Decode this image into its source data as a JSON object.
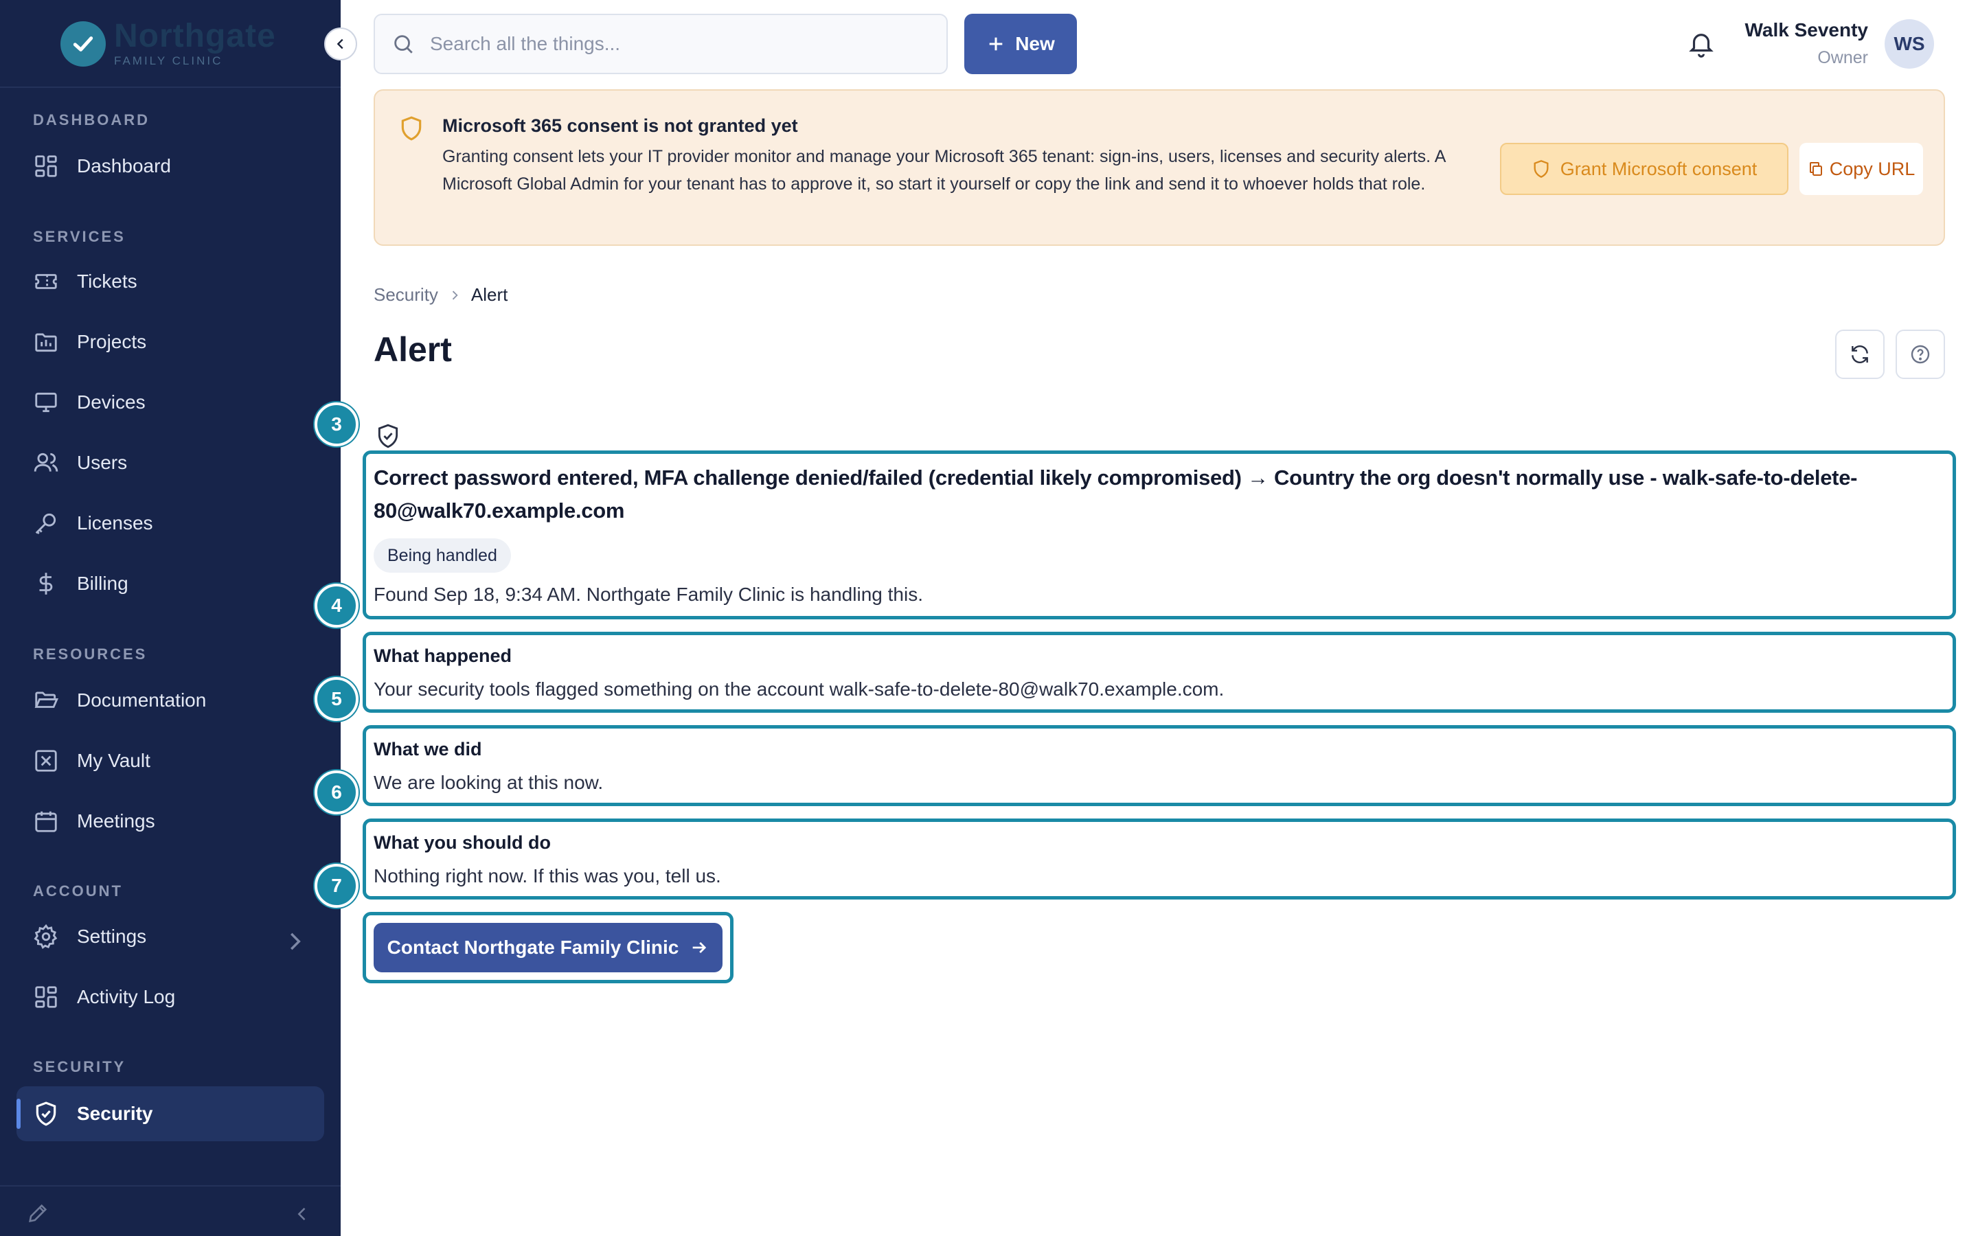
{
  "brand": {
    "name": "Northgate",
    "subtitle": "FAMILY CLINIC"
  },
  "sidebar": {
    "sections": {
      "dashboard": "DASHBOARD",
      "services": "SERVICES",
      "resources": "RESOURCES",
      "account": "ACCOUNT",
      "security": "SECURITY"
    },
    "items": {
      "dashboard": "Dashboard",
      "tickets": "Tickets",
      "projects": "Projects",
      "devices": "Devices",
      "users": "Users",
      "licenses": "Licenses",
      "billing": "Billing",
      "documentation": "Documentation",
      "vault": "My Vault",
      "meetings": "Meetings",
      "settings": "Settings",
      "activity_log": "Activity Log",
      "security": "Security"
    },
    "active_item": "Security"
  },
  "topbar": {
    "search_placeholder": "Search all the things...",
    "new_label": "New",
    "user_name": "Walk Seventy",
    "user_role": "Owner",
    "avatar_initials": "WS"
  },
  "banner": {
    "title": "Microsoft 365 consent is not granted yet",
    "body": "Granting consent lets your IT provider monitor and manage your Microsoft 365 tenant: sign-ins, users, licenses and security alerts. A Microsoft Global Admin for your tenant has to approve it, so start it yourself or copy the link and send it to whoever holds that role.",
    "grant_label": "Grant Microsoft consent",
    "copy_label": "Copy URL"
  },
  "breadcrumb": {
    "parent": "Security",
    "current": "Alert"
  },
  "page": {
    "title": "Alert"
  },
  "alert": {
    "title": "Correct password entered, MFA challenge denied/failed (credential likely compromised) → Country the org doesn't normally use - walk-safe-to-delete-80@walk70.example.com",
    "status": "Being handled",
    "found": "Found Sep 18, 9:34 AM. Northgate Family Clinic is handling this.",
    "what_happened_title": "What happened",
    "what_happened_body": "Your security tools flagged something on the account walk-safe-to-delete-80@walk70.example.com.",
    "what_we_did_title": "What we did",
    "what_we_did_body": "We are looking at this now.",
    "what_you_do_title": "What you should do",
    "what_you_do_body": "Nothing right now. If this was you, tell us.",
    "contact_label": "Contact Northgate Family Clinic"
  },
  "steps": [
    "3",
    "4",
    "5",
    "6",
    "7"
  ],
  "colors": {
    "sidebar_bg": "#17244a",
    "primary": "#3f5ba8",
    "highlight": "#1a8aa6",
    "banner_bg": "#fbeee0",
    "warning_accent": "#d98a1d"
  }
}
